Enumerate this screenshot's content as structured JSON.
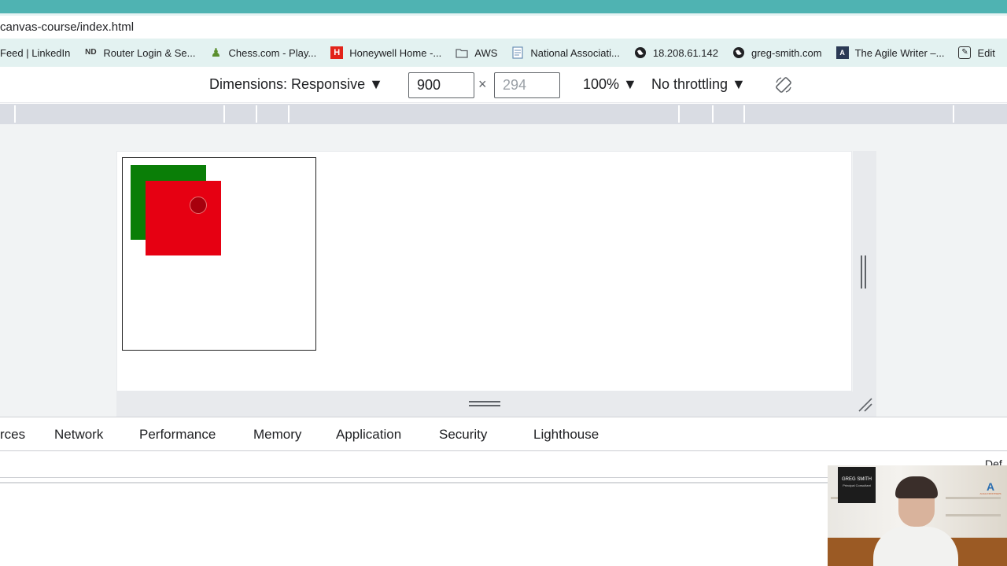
{
  "browser": {
    "url": "canvas-course/index.html",
    "accent_color": "#4fb3b2"
  },
  "bookmarks": [
    {
      "label": "Feed | LinkedIn",
      "icon": "none"
    },
    {
      "label": "Router Login & Se...",
      "icon": "nd-logo-icon",
      "glyph": "ND"
    },
    {
      "label": "Chess.com - Play...",
      "icon": "chess-pawn-icon",
      "glyph": "♟"
    },
    {
      "label": "Honeywell Home -...",
      "icon": "honeywell-icon",
      "glyph": "H"
    },
    {
      "label": "AWS",
      "icon": "folder-icon",
      "glyph": "▭"
    },
    {
      "label": "National Associati...",
      "icon": "document-icon",
      "glyph": "▤"
    },
    {
      "label": "18.208.61.142",
      "icon": "globe-icon",
      "glyph": "◉"
    },
    {
      "label": "greg-smith.com",
      "icon": "globe-icon",
      "glyph": "◉"
    },
    {
      "label": "The Agile Writer –...",
      "icon": "agile-writer-icon",
      "glyph": "A"
    },
    {
      "label": "Edit",
      "icon": "edit-icon",
      "glyph": "✎"
    }
  ],
  "device_toolbar": {
    "dimensions_label": "Dimensions: Responsive ▼",
    "width_value": "900",
    "height_placeholder": "294",
    "times_sign": "×",
    "zoom_label": "100% ▼",
    "throttling_label": "No throttling ▼"
  },
  "canvas_scene": {
    "back_rect_color": "#0a7e07",
    "front_rect_color": "#e60012",
    "dot_color": "#a7000d"
  },
  "devtools_tabs": [
    {
      "label": "rces"
    },
    {
      "label": "Network"
    },
    {
      "label": "Performance"
    },
    {
      "label": "Memory"
    },
    {
      "label": "Application"
    },
    {
      "label": "Security"
    },
    {
      "label": "Lighthouse"
    }
  ],
  "webcam": {
    "name": "GREG SMITH",
    "title": "Principal Consultant",
    "brand_mark": "A",
    "brand_text": "AGILE FRONTIERS"
  },
  "corner_peek_text": "Def"
}
